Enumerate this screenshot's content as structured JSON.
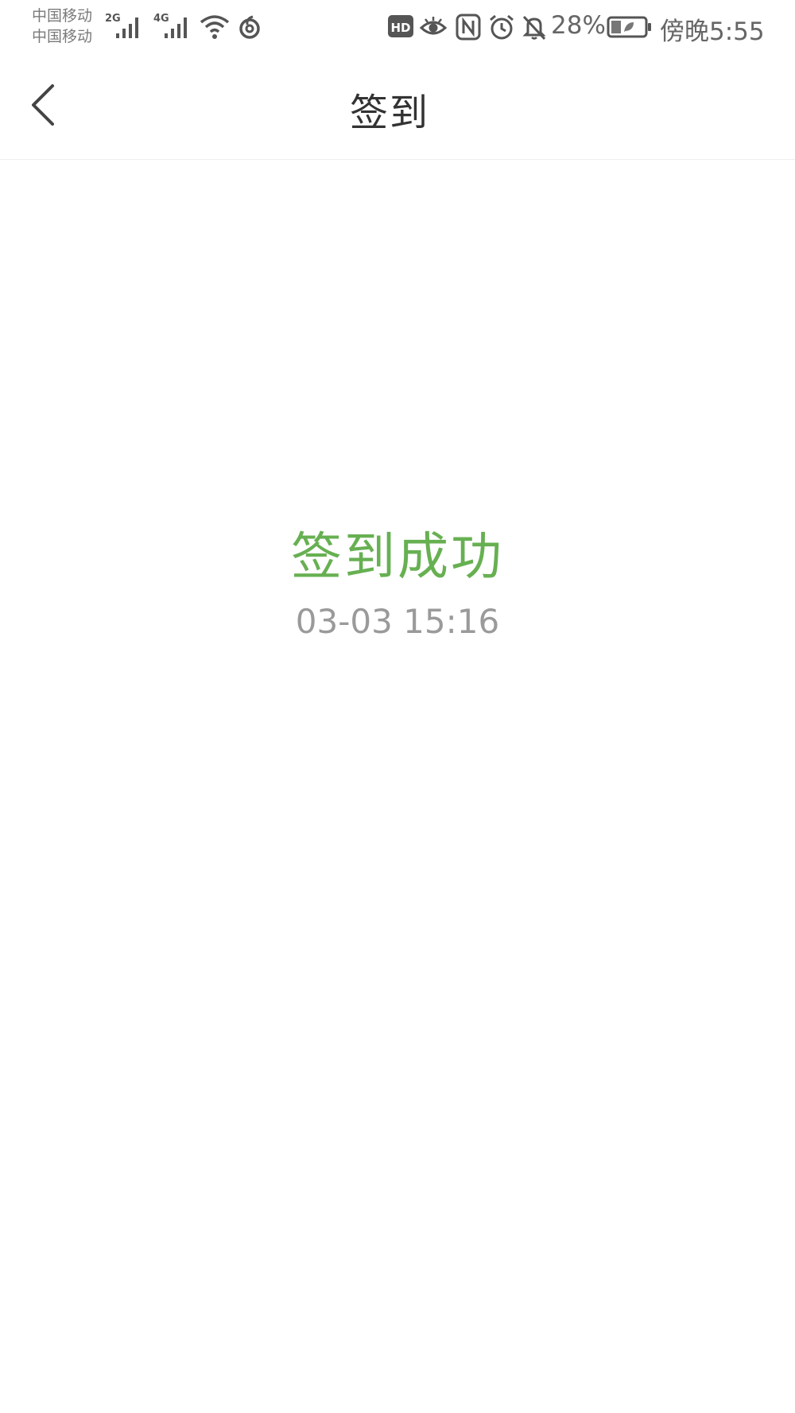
{
  "status_bar": {
    "carrier_1": "中国移动",
    "carrier_2": "中国移动",
    "signal_1_type": "2G",
    "signal_2_type": "4G",
    "battery_percent": "28%",
    "time": "傍晚5:55",
    "icons": [
      "signal-icon",
      "signal-icon",
      "wifi-icon",
      "netease-music-icon",
      "hd-icon",
      "eye-comfort-icon",
      "nfc-icon",
      "alarm-icon",
      "mute-icon",
      "battery-icon"
    ]
  },
  "header": {
    "title": "签到",
    "back_icon": "chevron-left-icon"
  },
  "main": {
    "status_text": "签到成功",
    "timestamp": "03-03 15:16"
  },
  "colors": {
    "success": "#67b052",
    "timestamp": "#9a9a9a",
    "title": "#333333"
  }
}
